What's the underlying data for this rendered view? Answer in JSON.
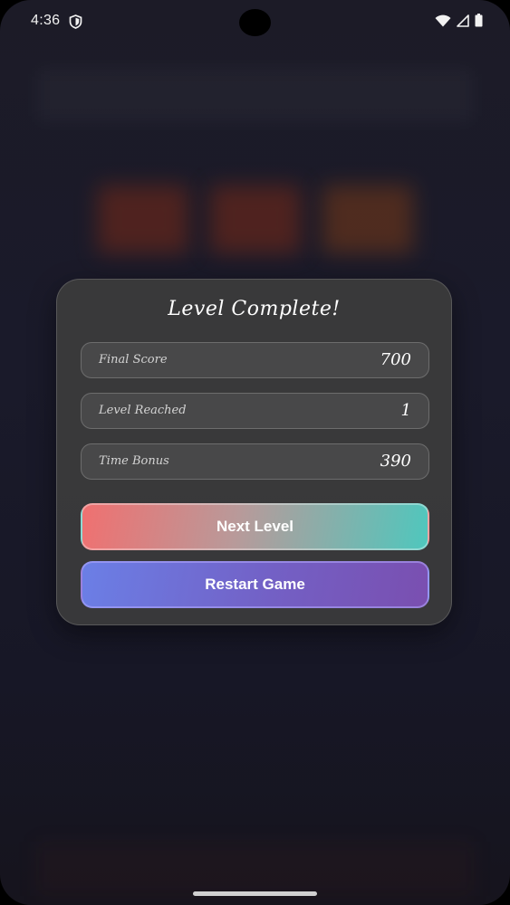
{
  "status_bar": {
    "time": "4:36",
    "icons": [
      "shield-icon",
      "wifi-icon",
      "cellular-signal-icon",
      "battery-icon"
    ]
  },
  "dialog": {
    "title": "Level Complete!",
    "stats": [
      {
        "label": "Final Score",
        "value": "700"
      },
      {
        "label": "Level Reached",
        "value": "1"
      },
      {
        "label": "Time Bonus",
        "value": "390"
      }
    ],
    "next_level_label": "Next Level",
    "restart_label": "Restart Game"
  },
  "colors": {
    "next_gradient_start": "#f07070",
    "next_gradient_end": "#4fc7bd",
    "restart_gradient_start": "#6b7fe6",
    "restart_gradient_end": "#7a4fb0",
    "background": "#1c1b27"
  }
}
